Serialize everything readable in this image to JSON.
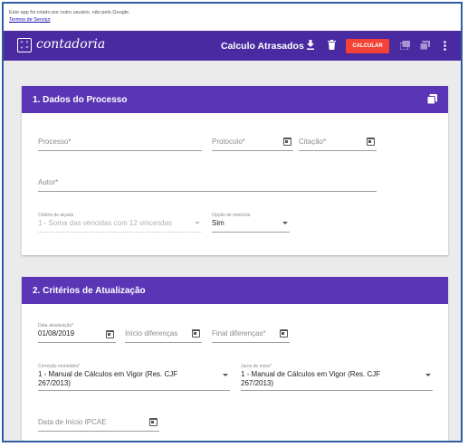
{
  "google_bar": {
    "notice": "Este app foi criado por outro usuário, não pelo Google.",
    "terms_link": "Termos de Serviço"
  },
  "app": {
    "logo_text": "contadoria",
    "title": "Calculo Atrasados",
    "calculate_label": "CALCULAR",
    "brand_color": "#4a2aa0",
    "accent_color": "#f44336"
  },
  "section1": {
    "title": "1. Dados do Processo",
    "fields": {
      "processo": {
        "label": "Processo*"
      },
      "protocolo": {
        "label": "Protocolo*"
      },
      "citacao": {
        "label": "Citação*"
      },
      "autor": {
        "label": "Autor*"
      },
      "criterio_alcada": {
        "label": "Critério de alçada",
        "value": "1 - Soma das vencidas com 12 vincendas"
      },
      "opcao_renuncia": {
        "label": "Opção de renúncia",
        "value": "Sim"
      }
    }
  },
  "section2": {
    "title": "2. Critérios de Atualização",
    "fields": {
      "data_atualizacao": {
        "label": "Data atualização*",
        "value": "01/08/2019"
      },
      "inicio_diferencas": {
        "label": "Início diferenças"
      },
      "final_diferencas": {
        "label": "Final diferenças*"
      },
      "correcao_monetaria": {
        "label": "Correção monetária*",
        "value_line1": "1 - Manual de Cálculos em Vigor (Res. CJF",
        "value_line2": "267/2013)"
      },
      "juros_mora": {
        "label": "Juros de mora*",
        "value_line1": "1 - Manual de Cálculos em Vigor (Res. CJF",
        "value_line2": "267/2013)"
      },
      "data_inicio_ipcae": {
        "label": "Data de Início IPCAE"
      }
    }
  }
}
